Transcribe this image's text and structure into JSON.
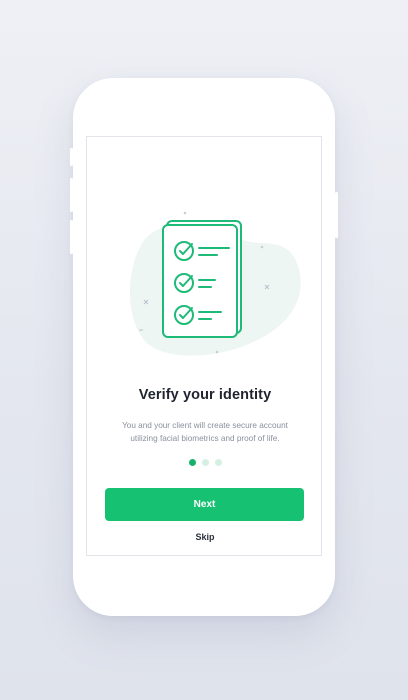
{
  "onboarding": {
    "title": "Verify your identity",
    "description": "You and your client will create secure account utilizing facial biometrics and proof of life.",
    "next_label": "Next",
    "skip_label": "Skip",
    "pagination": {
      "total": 3,
      "active": 1
    }
  },
  "colors": {
    "accent": "#16c172",
    "dot_inactive": "#d6efe3",
    "blob": "#eef6f3",
    "title": "#1f2430",
    "muted": "#8a8f9c"
  },
  "icons": [
    "checklist-illustration",
    "check-circle-icon",
    "sparkle-icon"
  ]
}
